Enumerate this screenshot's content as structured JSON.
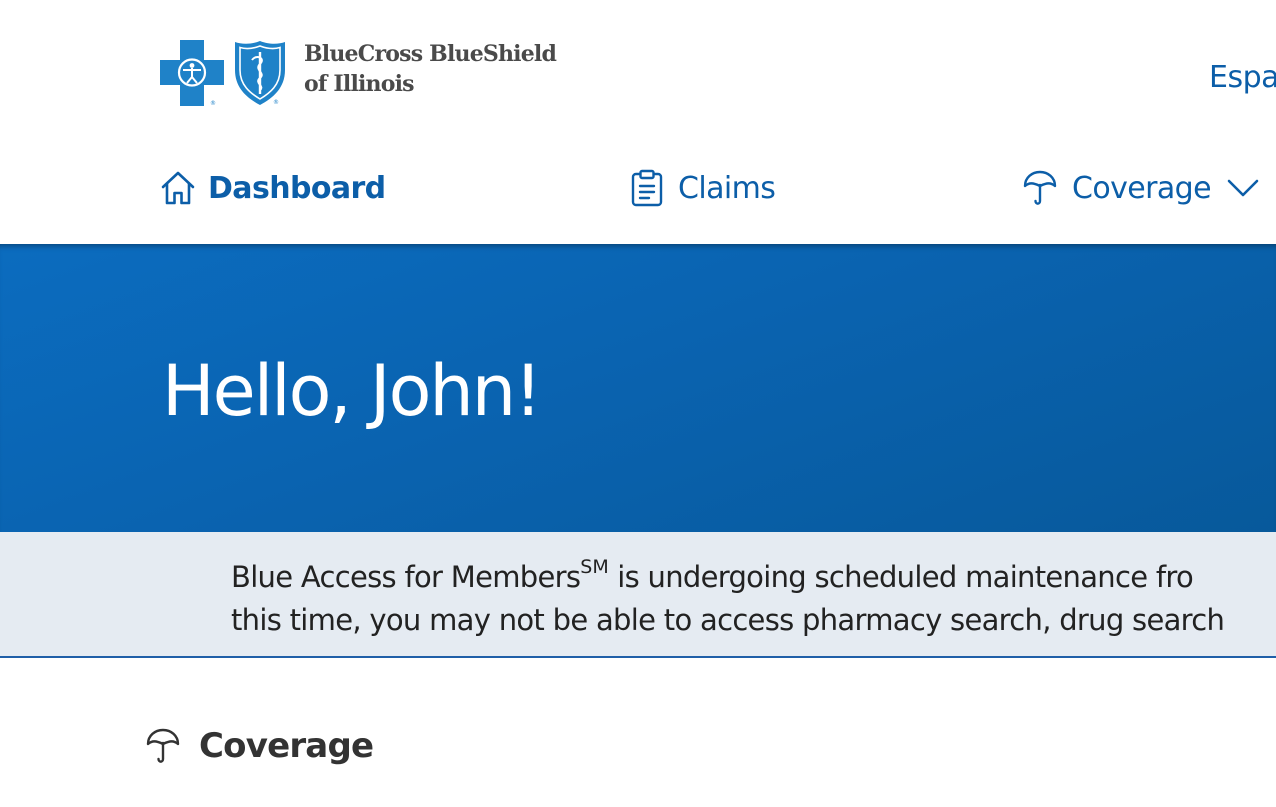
{
  "header": {
    "brand_line1": "BlueCross BlueShield",
    "brand_line2": "of Illinois",
    "language_link": "Espa"
  },
  "nav": {
    "dashboard": "Dashboard",
    "claims": "Claims",
    "coverage": "Coverage",
    "active": "Dashboard"
  },
  "hero": {
    "greeting": "Hello, John!"
  },
  "alert": {
    "line1_before_sup": "Blue Access for Members",
    "line1_sup": "SM",
    "line1_after_sup": " is undergoing scheduled maintenance fro",
    "line2": "this time, you may not be able to access pharmacy search, drug search"
  },
  "coverage_section": {
    "title": "Coverage",
    "icon": "umbrella-icon"
  },
  "colors": {
    "brand_blue": "#0c5ea8",
    "hero_blue": "#0a63b0",
    "alert_bg": "#e5ebf2",
    "alert_border": "#1f5fa8",
    "text_dark": "#333333"
  }
}
